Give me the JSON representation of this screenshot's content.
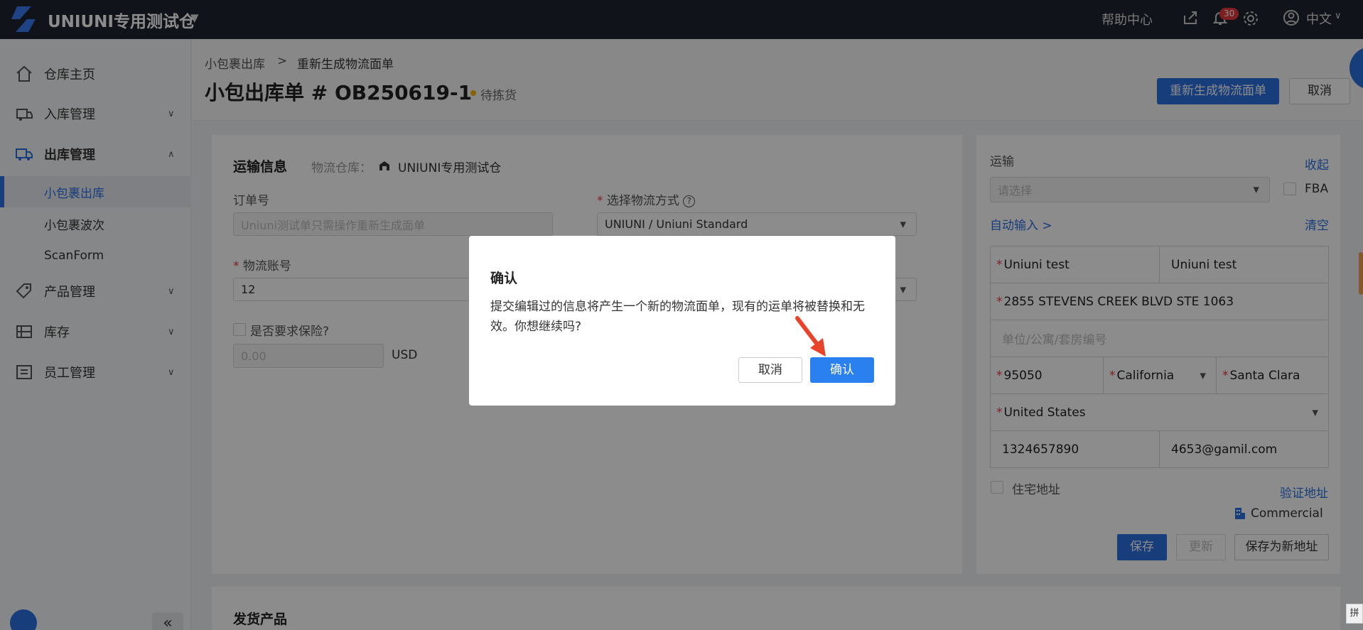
{
  "topbar": {
    "app_title": "UNIUNI专用测试仓",
    "help_label": "帮助中心",
    "notification_count": "30",
    "language": "中文"
  },
  "sidebar": {
    "items": [
      {
        "label": "仓库主页",
        "icon": "home-icon"
      },
      {
        "label": "入库管理",
        "icon": "inbound-icon"
      },
      {
        "label": "出库管理",
        "icon": "outbound-truck-icon"
      },
      {
        "label": "产品管理",
        "icon": "tag-icon"
      },
      {
        "label": "库存",
        "icon": "inventory-icon"
      },
      {
        "label": "员工管理",
        "icon": "staff-icon"
      }
    ],
    "subitems": [
      {
        "label": "小包裹出库",
        "active": true
      },
      {
        "label": "小包裹波次",
        "active": false
      },
      {
        "label": "ScanForm",
        "active": false
      }
    ],
    "collapse_label": "«"
  },
  "header": {
    "breadcrumb_parent": "小包裹出库",
    "breadcrumb_sep": ">",
    "breadcrumb_current": "重新生成物流面单",
    "title": "小包出库单 # OB250619-1",
    "status": "待拣货",
    "regen_button": "重新生成物流面单",
    "cancel_button": "取消"
  },
  "shipping": {
    "section_title": "运输信息",
    "warehouse_label": "物流仓库：",
    "warehouse_name": "UNIUNI专用测试仓",
    "order_no_label": "订单号",
    "order_no_placeholder": "Uniuni测试单只需操作重新生成面单",
    "method_label": "选择物流方式",
    "method_value": "UNIUNI / Uniuni Standard",
    "account_label": "物流账号",
    "account_value": "12",
    "insurance_label": "是否要求保险?",
    "insurance_placeholder": "0.00",
    "currency": "USD"
  },
  "address": {
    "section_title": "运输",
    "collapse_link": "收起",
    "select_placeholder": "请选择",
    "fba_label": "FBA",
    "auto_input_link": "自动输入 >",
    "clear_link": "清空",
    "first_name": "Uniuni test",
    "last_name": "Uniuni test",
    "street": "2855 STEVENS CREEK BLVD STE 1063",
    "unit_placeholder": "单位/公寓/套房编号",
    "zip": "95050",
    "state": "California",
    "city": "Santa Clara",
    "country": "United States",
    "phone": "1324657890",
    "email": "4653@gamil.com",
    "residential_label": "住宅地址",
    "verify_link": "验证地址",
    "address_type": "Commercial",
    "save_button": "保存",
    "update_button": "更新",
    "save_new_button": "保存为新地址"
  },
  "products": {
    "section_title": "发货产品"
  },
  "dialog": {
    "title": "确认",
    "body": "提交编辑过的信息将产生一个新的物流面单，现有的运单将被替换和无效。你想继续吗?",
    "cancel": "取消",
    "confirm": "确认"
  },
  "ime_chip": "拼",
  "colors": {
    "accent": "#2b6fe0",
    "topbar": "#1e2330",
    "danger": "#e4393c"
  }
}
